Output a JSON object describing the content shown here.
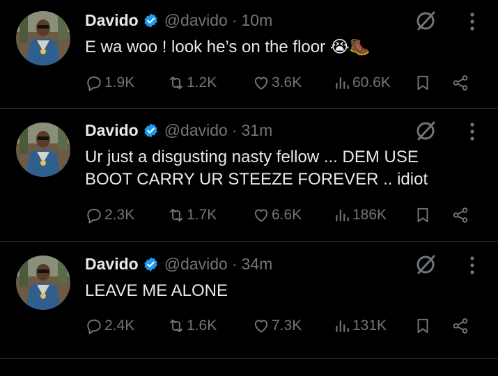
{
  "tweets": [
    {
      "name": "Davido",
      "handle": "@davido",
      "dot": "·",
      "time": "10m",
      "text": "E wa woo ! look he’s on the floor 😭🥾",
      "replies": "1.9K",
      "retweets": "1.2K",
      "likes": "3.6K",
      "views": "60.6K"
    },
    {
      "name": "Davido",
      "handle": "@davido",
      "dot": "·",
      "time": "31m",
      "text": "Ur just a disgusting nasty fellow ... DEM USE BOOT CARRY UR STEEZE FOREVER .. idiot",
      "replies": "2.3K",
      "retweets": "1.7K",
      "likes": "6.6K",
      "views": "186K"
    },
    {
      "name": "Davido",
      "handle": "@davido",
      "dot": "·",
      "time": "34m",
      "text": "LEAVE ME ALONE",
      "replies": "2.4K",
      "retweets": "1.6K",
      "likes": "7.3K",
      "views": "131K"
    }
  ],
  "colors": {
    "background": "#000000",
    "text": "#e7e9ea",
    "muted": "#71767b",
    "verified": "#1d9bf0",
    "divider": "#2f3336"
  },
  "icons": {
    "reply": "reply-icon",
    "retweet": "retweet-icon",
    "like": "heart-icon",
    "views": "views-icon",
    "bookmark": "bookmark-icon",
    "share": "share-icon",
    "grok": "grok-icon",
    "more": "more-icon",
    "verified": "verified-badge-icon"
  }
}
